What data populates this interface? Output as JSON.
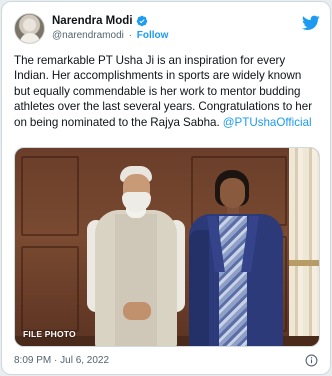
{
  "tweet": {
    "author": {
      "display_name": "Narendra Modi",
      "handle": "@narendramodi",
      "separator": "·",
      "follow_label": "Follow"
    },
    "text_main": "The remarkable PT Usha Ji is an inspiration for every Indian. Her accomplishments in sports are widely known but equally commendable is her work to mentor budding athletes over the last several years. Congratulations to her on being nominated to the Rajya Sabha. ",
    "mention": "@PTUshaOfficial",
    "photo_caption": "FILE PHOTO",
    "timestamp": "8:09 PM · Jul 6, 2022"
  },
  "colors": {
    "accent": "#1d9bf0",
    "text": "#0f1419",
    "muted": "#536471",
    "border": "#cfd9de"
  },
  "icons": {
    "brand": "twitter-bird-icon",
    "verified": "verified-badge-icon",
    "info": "info-icon"
  }
}
